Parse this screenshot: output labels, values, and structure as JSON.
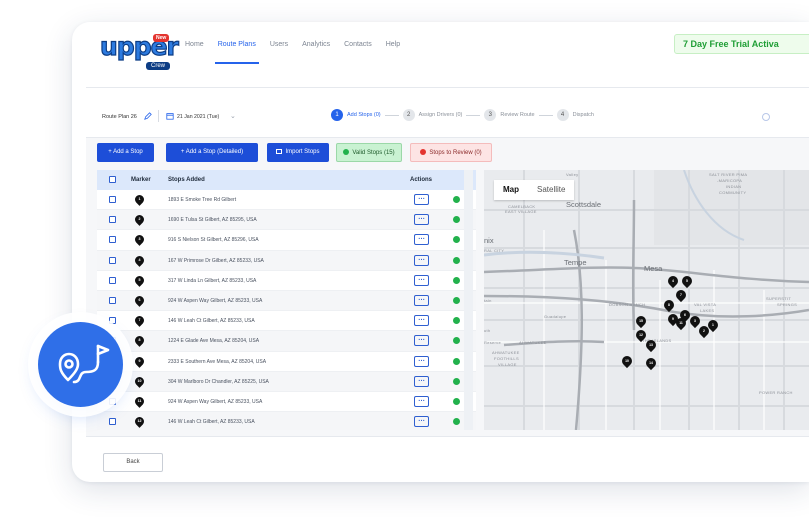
{
  "brand": {
    "logo_text": "upper",
    "logo_tag": "New",
    "logo_sub": "Crew",
    "accent": "#2563eb"
  },
  "nav": {
    "items": [
      "Home",
      "Route Plans",
      "Users",
      "Analytics",
      "Contacts",
      "Help"
    ],
    "active": "Route Plans",
    "trial": "7 Day Free Trial Activa"
  },
  "plan": {
    "name": "Route Plan 26",
    "date": "21 Jan 2021 (Tue)",
    "steps": [
      {
        "num": "1",
        "label": "Add Stops (0)"
      },
      {
        "num": "2",
        "label": "Assign Drivers (0)"
      },
      {
        "num": "3",
        "label": "Review Route"
      },
      {
        "num": "4",
        "label": "Dispatch"
      }
    ]
  },
  "actions": {
    "add_stop": "+ Add a Stop",
    "add_stop_detailed": "+ Add a Stop (Detailed)",
    "import": "Import Stops",
    "valid": "Valid Stops (15)",
    "review": "Stops to Review (0)"
  },
  "table": {
    "headers": {
      "marker": "Marker",
      "stops": "Stops Added",
      "actions": "Actions"
    },
    "rows": [
      {
        "n": "1",
        "address": "1893 E Smoke Tree Rd Gilbert"
      },
      {
        "n": "2",
        "address": "1690 E Tulsa St Gilbert, AZ 85295, USA"
      },
      {
        "n": "3",
        "address": "916 S Nielson St Gilbert, AZ 85296, USA"
      },
      {
        "n": "4",
        "address": "167 W Primrose Dr Gilbert, AZ 85233, USA"
      },
      {
        "n": "5",
        "address": "317 W Linda Ln Gilbert, AZ 85233, USA"
      },
      {
        "n": "6",
        "address": "924 W Aspen Way Gilbert, AZ 85233, USA"
      },
      {
        "n": "7",
        "address": "146 W Leah Ct Gilbert, AZ 85233, USA"
      },
      {
        "n": "8",
        "address": "1224 E Glade Ave Mesa, AZ 85204, USA"
      },
      {
        "n": "9",
        "address": "2333 E Southern Ave Mesa, AZ 85204, USA"
      },
      {
        "n": "10",
        "address": "304 W Marlboro Dr Chandler, AZ 85225, USA"
      },
      {
        "n": "11",
        "address": "924 W Aspen Way Gilbert, AZ 85233, USA"
      },
      {
        "n": "12",
        "address": "146 W Leah Ct Gilbert, AZ 85233, USA"
      }
    ]
  },
  "map": {
    "tabs": [
      "Map",
      "Satellite"
    ],
    "labels": {
      "scottsdale": "Scottsdale",
      "tempe": "Tempe",
      "mesa": "Mesa",
      "nix": "nix",
      "salt_river": "SALT RIVER PIMA",
      "maricopa": "-MARICOPA",
      "indian": "INDIAN",
      "community": "COMMUNITY",
      "camelback": "CAMELBACK",
      "east_village": "EAST VILLAGE",
      "ral_city": "RAL CITY",
      "dobson": "DOBSON RANCH",
      "val_vista": "VAL VISTA",
      "lakes": "LAKES",
      "superstition": "SUPERSTIT",
      "springs": "SPRINGS",
      "guadalupe": "Guadalupe",
      "ahwatukee": "AHWATUKEE",
      "foothills": "FOOTHILLS",
      "village": "VILLAGE",
      "islands": "THE ISLANDS",
      "power_ranch": "POWER RANCH",
      "valley": "Valley",
      "uth": "uth",
      "tain": "tain",
      "reserve": "Reserve"
    },
    "pins": [
      "4",
      "5",
      "7",
      "8",
      "6",
      "3",
      "2",
      "1",
      "15",
      "12",
      "13",
      "10",
      "14",
      "11",
      "9"
    ]
  },
  "footer": {
    "back": "Back"
  }
}
